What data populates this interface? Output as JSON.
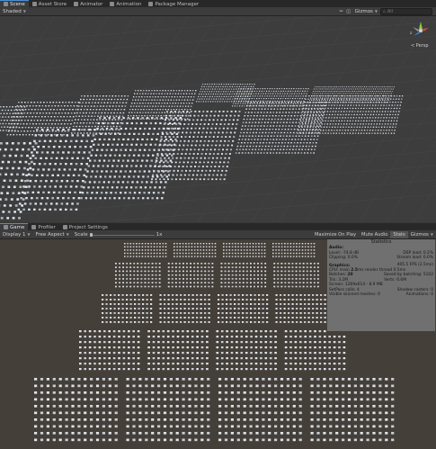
{
  "scene_tabs": [
    {
      "label": "Scene",
      "icon": "scene-icon",
      "active": true
    },
    {
      "label": "Asset Store",
      "icon": "asset-store-icon",
      "active": false
    },
    {
      "label": "Animator",
      "icon": "animator-icon",
      "active": false
    },
    {
      "label": "Animation",
      "icon": "animation-icon",
      "active": false
    },
    {
      "label": "Package Manager",
      "icon": "package-icon",
      "active": false
    }
  ],
  "scene_toolbar": {
    "shading_mode": "Shaded",
    "gizmos_label": "Gizmos",
    "search_placeholder": "All"
  },
  "gizmo": {
    "perspective_label": "< Persp"
  },
  "game_tabs": [
    {
      "label": "Game",
      "icon": "game-icon",
      "active": true
    },
    {
      "label": "Profiler",
      "icon": "profiler-icon",
      "active": false
    },
    {
      "label": "Project Settings",
      "icon": "settings-icon",
      "active": false
    }
  ],
  "game_toolbar": {
    "display": "Display 1",
    "aspect": "Free Aspect",
    "scale_label": "Scale",
    "scale_value": "1x",
    "maximize_on_play": "Maximize On Play",
    "mute_audio": "Mute Audio",
    "stats": "Stats",
    "gizmos": "Gizmos"
  },
  "stats": {
    "title": "Statistics",
    "audio_header": "Audio:",
    "level": "Level: -74.8 dB",
    "dsp_load": "DSP load: 0.2%",
    "clipping": "Clipping: 0.0%",
    "stream_load": "Stream load: 0.0%",
    "graphics_header": "Graphics:",
    "fps": "405.5 FPS (2.5ms)",
    "cpu_prefix": "CPU: main",
    "cpu_main": "2.5",
    "cpu_suffix": "ms  render thread 0.5ms",
    "batches_prefix": "Batches:",
    "batches": "20",
    "saved_batching": "Saved by batching: 5102",
    "tris": "Tris: 3.2M",
    "verts": "Verts: 6.6M",
    "screen": "Screen: 1269x614 - 8.9 MB",
    "setpass": "SetPass calls: 4",
    "shadow_casters": "Shadow casters: 0",
    "skinned": "Visible skinned meshes: 0",
    "animations": "Animations: 0"
  },
  "colors": {
    "accent": "#4a8fd6",
    "viewport_bg": "#3d3d3d",
    "game_bg": "#453f39",
    "unit_fill": "#dfe3ea"
  }
}
